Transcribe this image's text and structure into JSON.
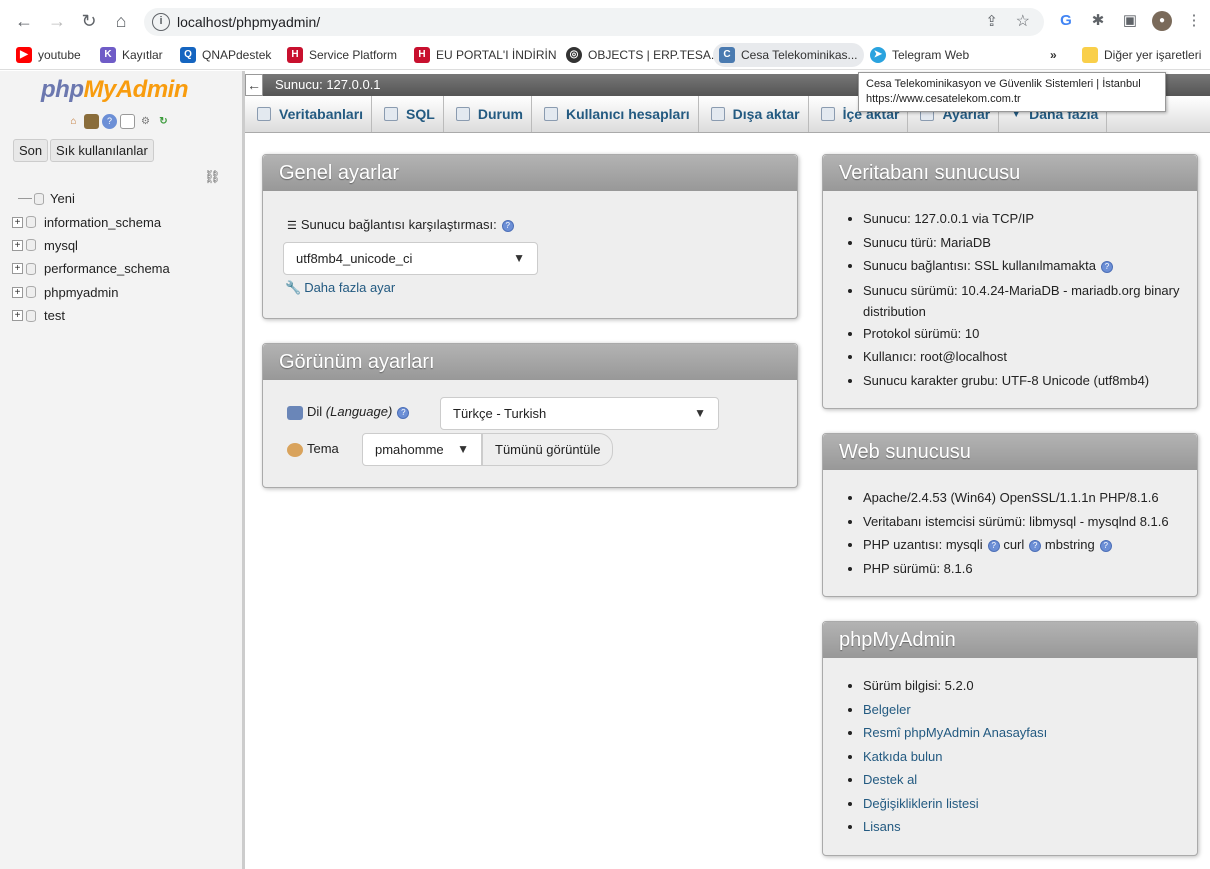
{
  "browser": {
    "url": "localhost/phpmyadmin/",
    "bookmarks": [
      {
        "label": "youtube",
        "color": "#ff0000"
      },
      {
        "label": "Kayıtlar",
        "color": "#6f5cc7"
      },
      {
        "label": "QNAPdestek",
        "color": "#1565c0"
      },
      {
        "label": "Service Platform",
        "color": "#c8102e"
      },
      {
        "label": "EU PORTAL'I İNDİRİN",
        "color": "#c8102e"
      },
      {
        "label": "OBJECTS | ERP.TESA...",
        "color": "#333333"
      },
      {
        "label": "Cesa Telekominikas...",
        "color": "#4a7ab0"
      },
      {
        "label": "Telegram Web",
        "color": "#2aa3df"
      }
    ],
    "more": "»",
    "other_bookmarks": "Diğer yer işaretleri"
  },
  "tooltip": {
    "line1": "Cesa Telekominikasyon ve Güvenlik Sistemleri | İstanbul",
    "line2": "https://www.cesatelekom.com.tr"
  },
  "sidebar": {
    "logo_php": "php",
    "logo_myadmin": "MyAdmin",
    "tab_recent": "Son",
    "tab_favorites": "Sık kullanılanlar",
    "new_label": "Yeni",
    "databases": [
      "information_schema",
      "mysql",
      "performance_schema",
      "phpmyadmin",
      "test"
    ]
  },
  "server_bar": "Sunucu: 127.0.0.1",
  "topmenu": [
    "Veritabanları",
    "SQL",
    "Durum",
    "Kullanıcı hesapları",
    "Dışa aktar",
    "İçe aktar",
    "Ayarlar",
    "Daha fazla"
  ],
  "general": {
    "title": "Genel ayarlar",
    "collation_label": "Sunucu bağlantısı karşılaştırması:",
    "collation_value": "utf8mb4_unicode_ci",
    "more_settings": "Daha fazla ayar"
  },
  "appearance": {
    "title": "Görünüm ayarları",
    "lang_label": "Dil",
    "lang_label_en": "(Language)",
    "lang_value": "Türkçe - Turkish",
    "theme_label": "Tema",
    "theme_value": "pmahomme",
    "view_all": "Tümünü görüntüle"
  },
  "db_server": {
    "title": "Veritabanı sunucusu",
    "items": [
      "Sunucu: 127.0.0.1 via TCP/IP",
      "Sunucu türü: MariaDB",
      "Sunucu bağlantısı: SSL kullanılmamakta",
      "Sunucu sürümü: 10.4.24-MariaDB - mariadb.org binary distribution",
      "Protokol sürümü: 10",
      "Kullanıcı: root@localhost",
      "Sunucu karakter grubu: UTF-8 Unicode (utf8mb4)"
    ]
  },
  "web_server": {
    "title": "Web sunucusu",
    "items": [
      "Apache/2.4.53 (Win64) OpenSSL/1.1.1n PHP/8.1.6",
      "Veritabanı istemcisi sürümü: libmysql - mysqlnd 8.1.6",
      "PHP uzantısı: mysqli",
      "PHP sürümü: 8.1.6"
    ],
    "ext_curl": "curl",
    "ext_mbstring": "mbstring"
  },
  "pma": {
    "title": "phpMyAdmin",
    "version": "Sürüm bilgisi: 5.2.0",
    "links": [
      "Belgeler",
      "Resmî phpMyAdmin Anasayfası",
      "Katkıda bulun",
      "Destek al",
      "Değişikliklerin listesi",
      "Lisans"
    ]
  }
}
